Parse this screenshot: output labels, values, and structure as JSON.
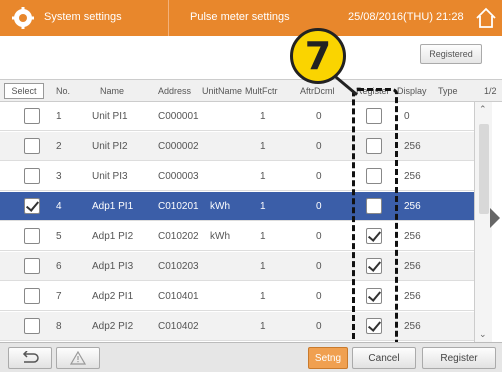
{
  "titlebar": {
    "section": "System settings",
    "screen": "Pulse meter settings",
    "datetime": "25/08/2016(THU) 21:28"
  },
  "header": {
    "registered_label": "Registered",
    "callout_number": "7",
    "page_indicator": "1/2"
  },
  "columns": {
    "select": "Select",
    "no": "No.",
    "name": "Name",
    "address": "Address",
    "unit_name": "UnitName",
    "mult_fctr": "MultFctr",
    "aftr_dcml": "AftrDcml",
    "register": "Register",
    "display": "Display",
    "type": "Type"
  },
  "rows": [
    {
      "no": "1",
      "name": "Unit PI1",
      "address": "C000001",
      "unit": "",
      "mult": "1",
      "aftr": "0",
      "display": "0",
      "selected": false,
      "registered": false
    },
    {
      "no": "2",
      "name": "Unit PI2",
      "address": "C000002",
      "unit": "",
      "mult": "1",
      "aftr": "0",
      "display": "256",
      "selected": false,
      "registered": false
    },
    {
      "no": "3",
      "name": "Unit PI3",
      "address": "C000003",
      "unit": "",
      "mult": "1",
      "aftr": "0",
      "display": "256",
      "selected": false,
      "registered": false
    },
    {
      "no": "4",
      "name": "Adp1 PI1",
      "address": "C010201",
      "unit": "kWh",
      "mult": "1",
      "aftr": "0",
      "display": "256",
      "selected": true,
      "registered": false
    },
    {
      "no": "5",
      "name": "Adp1 PI2",
      "address": "C010202",
      "unit": "kWh",
      "mult": "1",
      "aftr": "0",
      "display": "256",
      "selected": false,
      "registered": true
    },
    {
      "no": "6",
      "name": "Adp1 PI3",
      "address": "C010203",
      "unit": "",
      "mult": "1",
      "aftr": "0",
      "display": "256",
      "selected": false,
      "registered": true
    },
    {
      "no": "7",
      "name": "Adp2 PI1",
      "address": "C010401",
      "unit": "",
      "mult": "1",
      "aftr": "0",
      "display": "256",
      "selected": false,
      "registered": true
    },
    {
      "no": "8",
      "name": "Adp2 PI2",
      "address": "C010402",
      "unit": "",
      "mult": "1",
      "aftr": "0",
      "display": "256",
      "selected": false,
      "registered": true
    }
  ],
  "bottom": {
    "setng_label": "Setng",
    "cancel_label": "Cancel",
    "register_label": "Register"
  },
  "colors": {
    "title_bar": "#e8872c",
    "selected_row": "#3b5ea8",
    "callout": "#fad400"
  },
  "icons": [
    "gear-icon",
    "home-icon",
    "back-icon",
    "warning-icon",
    "scroll-up-icon",
    "scroll-down-icon",
    "next-page-icon"
  ]
}
